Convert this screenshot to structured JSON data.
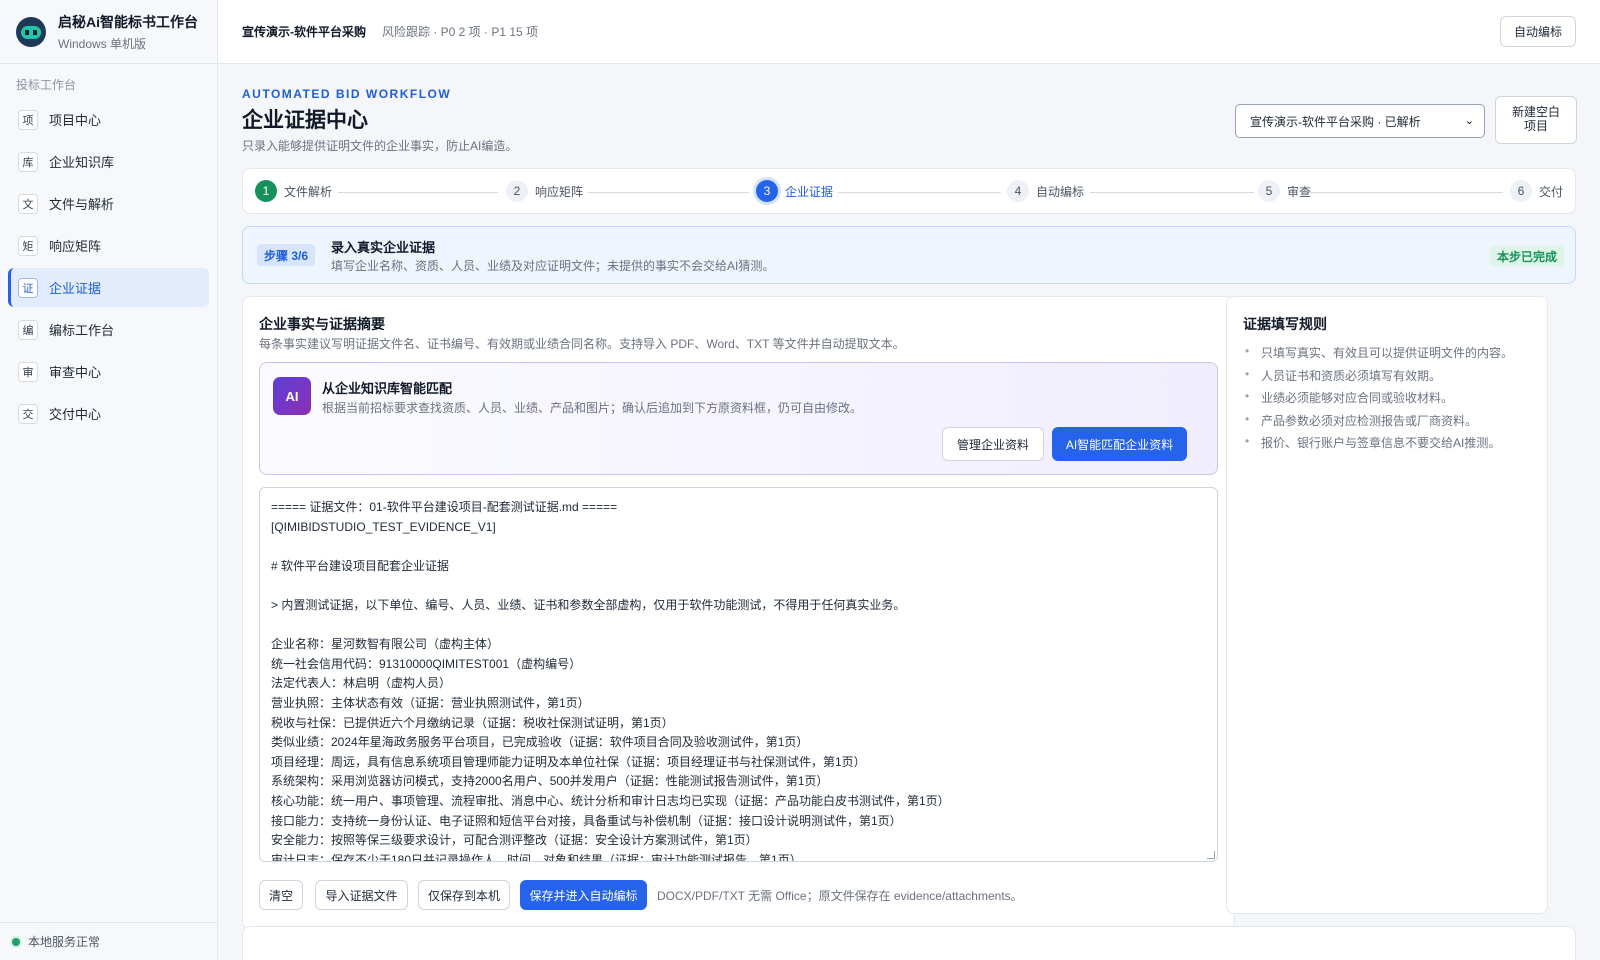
{
  "brand": {
    "title": "启秘Ai智能标书工作台",
    "subtitle": "Windows 单机版"
  },
  "sidebar": {
    "section": "投标工作台",
    "items": [
      {
        "icon": "项",
        "label": "项目中心"
      },
      {
        "icon": "库",
        "label": "企业知识库"
      },
      {
        "icon": "文",
        "label": "文件与解析"
      },
      {
        "icon": "矩",
        "label": "响应矩阵"
      },
      {
        "icon": "证",
        "label": "企业证据"
      },
      {
        "icon": "编",
        "label": "编标工作台"
      },
      {
        "icon": "审",
        "label": "审查中心"
      },
      {
        "icon": "交",
        "label": "交付中心"
      }
    ],
    "active_index": 4,
    "status": "本地服务正常"
  },
  "topbar": {
    "project": "宣传演示-软件平台采购",
    "risk": "风险跟踪 · P0 2 项 · P1 15 项",
    "auto_btn": "自动编标"
  },
  "header": {
    "eyebrow": "AUTOMATED BID WORKFLOW",
    "title": "企业证据中心",
    "desc": "只录入能够提供证明文件的企业事实，防止AI编造。",
    "project_select": "宣传演示-软件平台采购 · 已解析",
    "new_project_line1": "新建空白",
    "new_project_line2": "项目"
  },
  "stepper": {
    "steps": [
      {
        "num": "1",
        "label": "文件解析",
        "state": "done"
      },
      {
        "num": "2",
        "label": "响应矩阵",
        "state": "pending"
      },
      {
        "num": "3",
        "label": "企业证据",
        "state": "current"
      },
      {
        "num": "4",
        "label": "自动编标",
        "state": "pending"
      },
      {
        "num": "5",
        "label": "审查",
        "state": "pending"
      },
      {
        "num": "6",
        "label": "交付",
        "state": "pending"
      }
    ]
  },
  "banner": {
    "badge": "步骤 3/6",
    "title": "录入真实企业证据",
    "desc": "填写企业名称、资质、人员、业绩及对应证明文件；未提供的事实不会交给AI猜测。",
    "status": "本步已完成"
  },
  "evidence": {
    "title": "企业事实与证据摘要",
    "desc": "每条事实建议写明证据文件名、证书编号、有效期或业绩合同名称。支持导入 PDF、Word、TXT 等文件并自动提取文本。",
    "ai": {
      "icon": "AI",
      "title": "从企业知识库智能匹配",
      "desc": "根据当前招标要求查找资质、人员、业绩、产品和图片；确认后追加到下方原资料框，仍可自由修改。",
      "manage_btn": "管理企业资料",
      "match_btn": "AI智能匹配企业资料"
    },
    "text_lines": [
      "===== 证据文件：01-软件平台建设项目-配套测试证据.md =====",
      "[QIMIBIDSTUDIO_TEST_EVIDENCE_V1]",
      "",
      "# 软件平台建设项目配套企业证据",
      "",
      "> 内置测试证据，以下单位、编号、人员、业绩、证书和参数全部虚构，仅用于软件功能测试，不得用于任何真实业务。",
      "",
      "企业名称：星河数智有限公司（虚构主体）",
      "统一社会信用代码：91310000QIMITEST001（虚构编号）",
      "法定代表人：林启明（虚构人员）",
      "营业执照：主体状态有效（证据：营业执照测试件，第1页）",
      "税收与社保：已提供近六个月缴纳记录（证据：税收社保测试证明，第1页）",
      "类似业绩：2024年星海政务服务平台项目，已完成验收（证据：软件项目合同及验收测试件，第1页）",
      "项目经理：周远，具有信息系统项目管理师能力证明及本单位社保（证据：项目经理证书与社保测试件，第1页）",
      "系统架构：采用浏览器访问模式，支持2000名用户、500并发用户（证据：性能测试报告测试件，第1页）",
      "核心功能：统一用户、事项管理、流程审批、消息中心、统计分析和审计日志均已实现（证据：产品功能白皮书测试件，第1页）",
      "接口能力：支持统一身份认证、电子证照和短信平台对接，具备重试与补偿机制（证据：接口设计说明测试件，第1页）",
      "安全能力：按照等保三级要求设计，可配合测评整改（证据：安全设计方案测试件，第1页）",
      "审计日志：保存不少于180日并记录操作人、时间、对象和结果（证据：审计功能测试报告，第1页）"
    ],
    "actions": {
      "clear": "清空",
      "import": "导入证据文件",
      "save_local": "仅保存到本机",
      "save_next": "保存并进入自动编标",
      "note": "DOCX/PDF/TXT 无需 Office；原文件保存在 evidence/attachments。"
    }
  },
  "rules": {
    "title": "证据填写规则",
    "items": [
      "只填写真实、有效且可以提供证明文件的内容。",
      "人员证书和资质必须填写有效期。",
      "业绩必须能够对应合同或验收材料。",
      "产品参数必须对应检测报告或厂商资料。",
      "报价、银行账户与签章信息不要交给AI推测。"
    ]
  },
  "colors": {
    "accent": "#2563eb",
    "success": "#16915c",
    "ai": "#6d3fd0"
  }
}
